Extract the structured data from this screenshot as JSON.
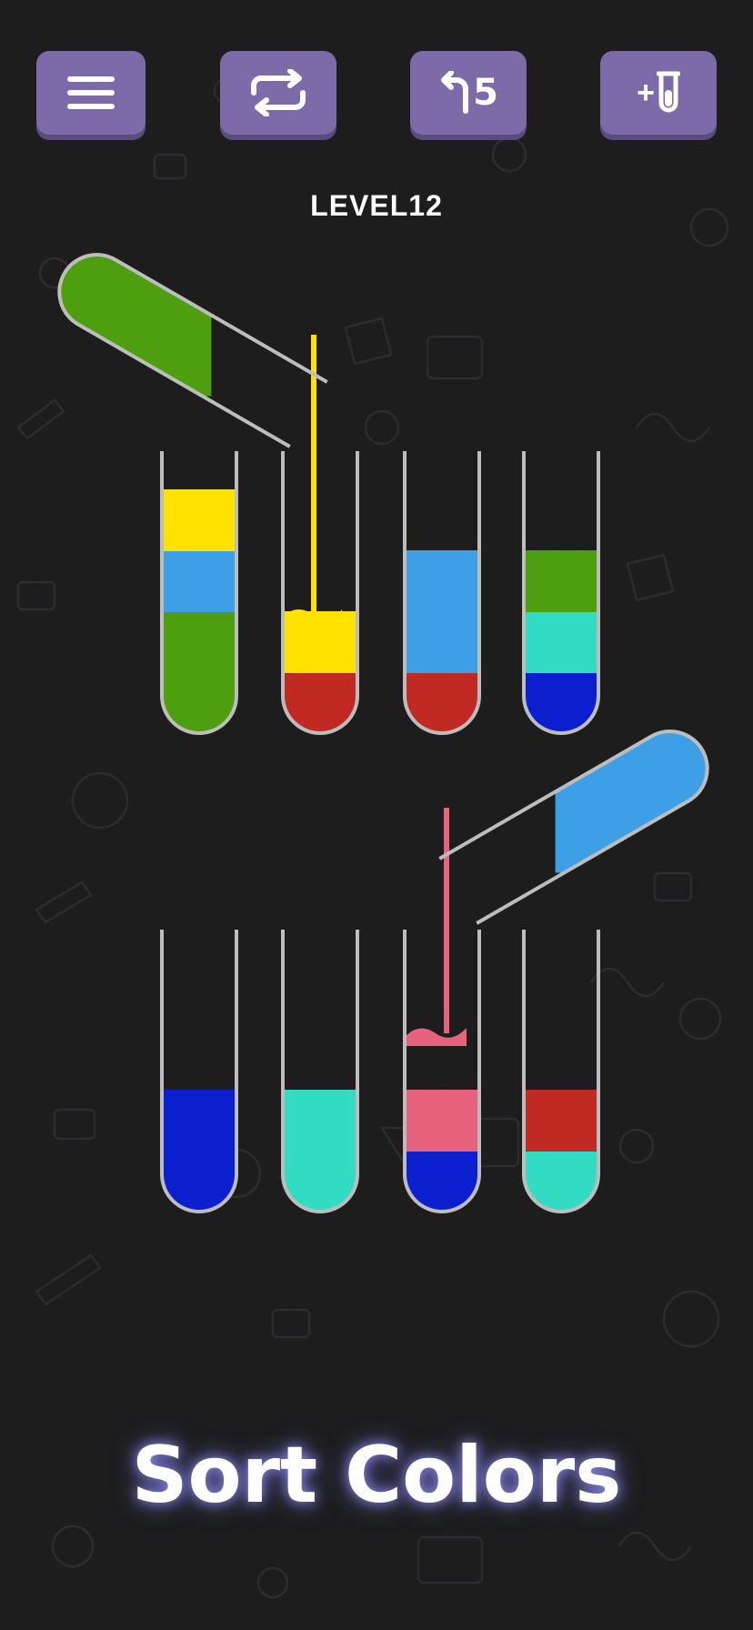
{
  "header": {
    "menu_icon": "hamburger-icon",
    "restart_icon": "repeat-arrows-icon",
    "undo_icon": "undo-arrow-icon",
    "undo_count": "5",
    "add_tube_icon": "plus-tube-icon",
    "add_tube_label": "+"
  },
  "level": {
    "label": "LEVEL12"
  },
  "title": "Sort Colors",
  "colors": {
    "yellow": "#ffe200",
    "green": "#4e9f10",
    "light_blue": "#3d9fe6",
    "red": "#c02a22",
    "teal": "#31dcc3",
    "dark_blue": "#0b1fcf",
    "pink": "#e7627d",
    "tube_outline": "#bdbdbd",
    "button": "#7d6aa9"
  },
  "tubes": [
    {
      "id": "tube-1",
      "row": 1,
      "layers_bottom_to_top": [
        "green",
        "green",
        "light_blue",
        "yellow"
      ]
    },
    {
      "id": "tube-2",
      "row": 1,
      "layers_bottom_to_top": [
        "red",
        "yellow"
      ]
    },
    {
      "id": "tube-3",
      "row": 1,
      "layers_bottom_to_top": [
        "red",
        "light_blue",
        "light_blue"
      ]
    },
    {
      "id": "tube-4",
      "row": 1,
      "layers_bottom_to_top": [
        "dark_blue",
        "teal",
        "green"
      ]
    },
    {
      "id": "tube-5",
      "row": 2,
      "layers_bottom_to_top": [
        "dark_blue",
        "dark_blue"
      ]
    },
    {
      "id": "tube-6",
      "row": 2,
      "layers_bottom_to_top": [
        "teal",
        "teal"
      ]
    },
    {
      "id": "tube-7",
      "row": 2,
      "layers_bottom_to_top": [
        "dark_blue",
        "pink"
      ]
    },
    {
      "id": "tube-8",
      "row": 2,
      "layers_bottom_to_top": [
        "teal",
        "red"
      ]
    }
  ],
  "pouring_tubes": [
    {
      "id": "pouring-tube-yellow",
      "contents": [
        "green",
        "yellow"
      ],
      "target": "tube-2"
    },
    {
      "id": "pouring-tube-pink",
      "contents": [
        "light_blue",
        "pink"
      ],
      "target": "tube-7"
    }
  ]
}
